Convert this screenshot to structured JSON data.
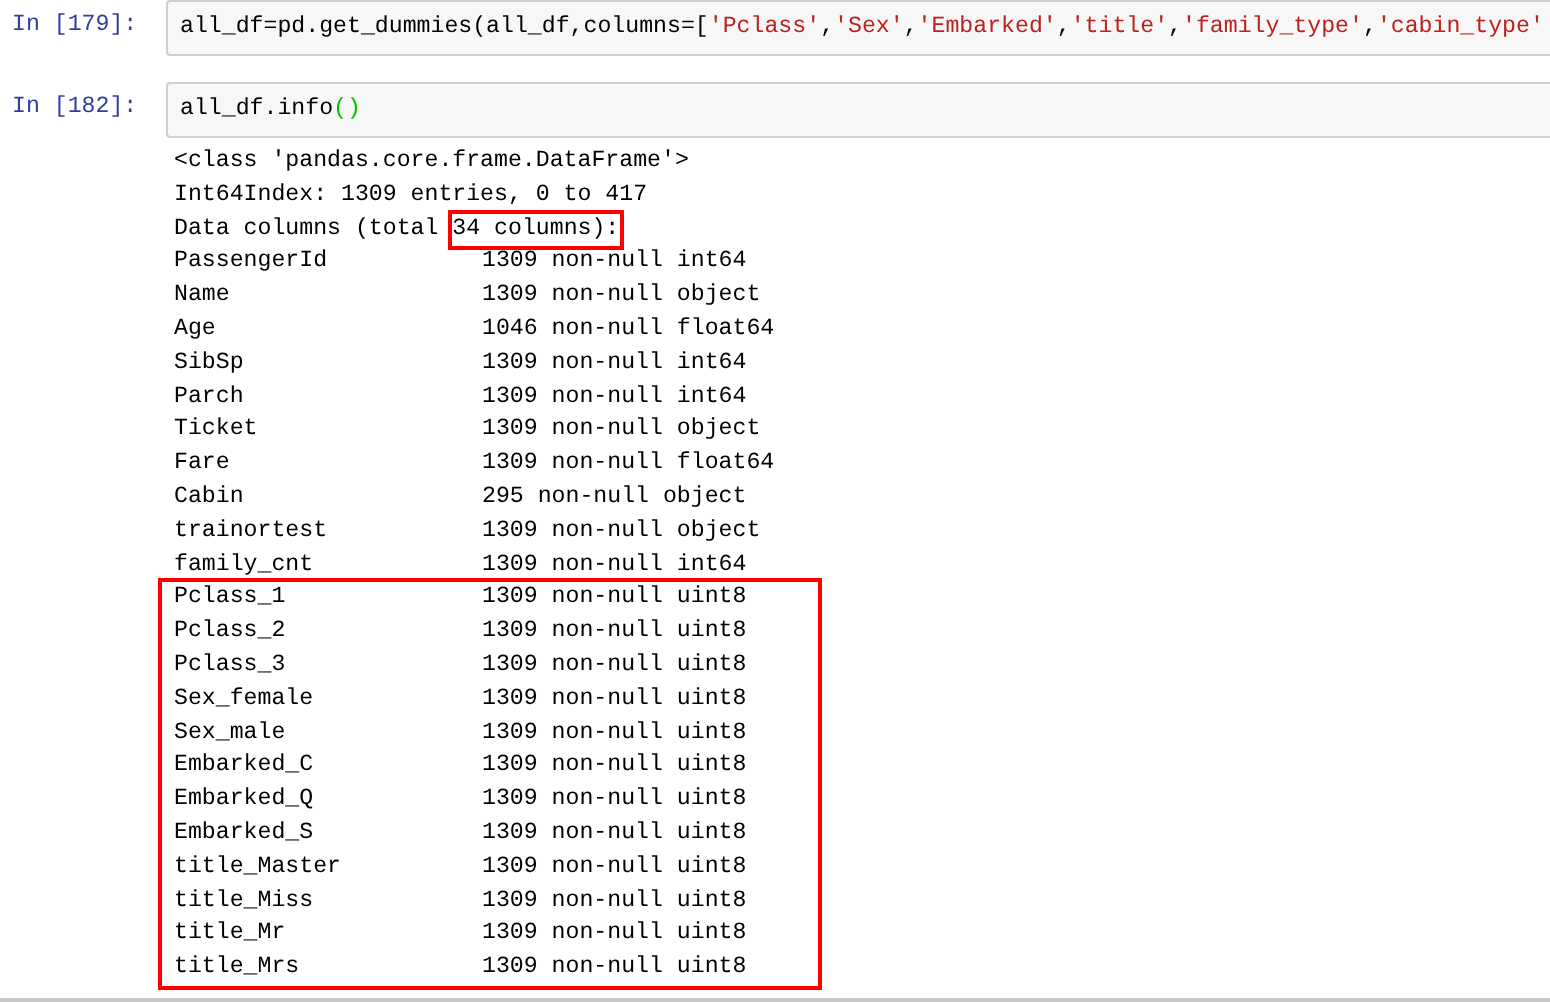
{
  "cells": [
    {
      "prompt": "In [179]:",
      "code": [
        {
          "kind": "plain",
          "text": "all_df=pd.get_dummies(all_df,columns=["
        },
        {
          "kind": "string",
          "text": "'Pclass'"
        },
        {
          "kind": "plain",
          "text": ","
        },
        {
          "kind": "string",
          "text": "'Sex'"
        },
        {
          "kind": "plain",
          "text": ","
        },
        {
          "kind": "string",
          "text": "'Embarked'"
        },
        {
          "kind": "plain",
          "text": ","
        },
        {
          "kind": "string",
          "text": "'title'"
        },
        {
          "kind": "plain",
          "text": ","
        },
        {
          "kind": "string",
          "text": "'family_type'"
        },
        {
          "kind": "plain",
          "text": ","
        },
        {
          "kind": "string",
          "text": "'cabin_type'"
        }
      ]
    },
    {
      "prompt": "In [182]:",
      "code": [
        {
          "kind": "plain",
          "text": "all_df.info"
        },
        {
          "kind": "paren",
          "text": "()"
        }
      ],
      "output": {
        "header": [
          [
            {
              "text": "<class 'pandas.core.frame.DataFrame'>",
              "highlighted": false
            }
          ],
          [
            {
              "text": "Int64Index: 1309 entries, 0 to 417",
              "highlighted": false
            }
          ],
          [
            {
              "text": "Data columns (total ",
              "highlighted": false
            },
            {
              "text": "34 columns):",
              "highlighted": true
            }
          ]
        ],
        "rows": [
          {
            "name": "PassengerId",
            "info": "1309 non-null int64",
            "highlighted": false
          },
          {
            "name": "Name",
            "info": "1309 non-null object",
            "highlighted": false
          },
          {
            "name": "Age",
            "info": "1046 non-null float64",
            "highlighted": false
          },
          {
            "name": "SibSp",
            "info": "1309 non-null int64",
            "highlighted": false
          },
          {
            "name": "Parch",
            "info": "1309 non-null int64",
            "highlighted": false
          },
          {
            "name": "Ticket",
            "info": "1309 non-null object",
            "highlighted": false
          },
          {
            "name": "Fare",
            "info": "1309 non-null float64",
            "highlighted": false
          },
          {
            "name": "Cabin",
            "info": "295 non-null object",
            "highlighted": false
          },
          {
            "name": "trainortest",
            "info": "1309 non-null object",
            "highlighted": false
          },
          {
            "name": "family_cnt",
            "info": "1309 non-null int64",
            "highlighted": false
          },
          {
            "name": "Pclass_1",
            "info": "1309 non-null uint8",
            "highlighted": true
          },
          {
            "name": "Pclass_2",
            "info": "1309 non-null uint8",
            "highlighted": true
          },
          {
            "name": "Pclass_3",
            "info": "1309 non-null uint8",
            "highlighted": true
          },
          {
            "name": "Sex_female",
            "info": "1309 non-null uint8",
            "highlighted": true
          },
          {
            "name": "Sex_male",
            "info": "1309 non-null uint8",
            "highlighted": true
          },
          {
            "name": "Embarked_C",
            "info": "1309 non-null uint8",
            "highlighted": true
          },
          {
            "name": "Embarked_Q",
            "info": "1309 non-null uint8",
            "highlighted": true
          },
          {
            "name": "Embarked_S",
            "info": "1309 non-null uint8",
            "highlighted": true
          },
          {
            "name": "title_Master",
            "info": "1309 non-null uint8",
            "highlighted": true
          },
          {
            "name": "title_Miss",
            "info": "1309 non-null uint8",
            "highlighted": true
          },
          {
            "name": "title_Mr",
            "info": "1309 non-null uint8",
            "highlighted": true
          },
          {
            "name": "title_Mrs",
            "info": "1309 non-null uint8",
            "highlighted": true
          }
        ]
      }
    }
  ]
}
